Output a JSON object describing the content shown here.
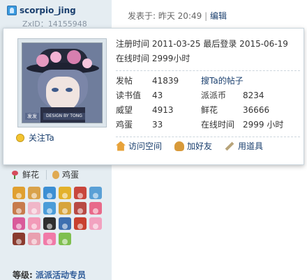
{
  "user": {
    "username": "scorpio_jing",
    "zxid": "ZxID：14155948"
  },
  "post": {
    "posted_label": "发表于: 昨天 20:49",
    "separator": "|",
    "edit_label": "编辑"
  },
  "card": {
    "register_line": "注册时间  2011-03-25  最后登录  2015-06-19",
    "online_line": "在线时间    2999小时",
    "avatar_tag_left": "发发",
    "avatar_tag_right": "DESIGN BY TONG",
    "follow_label": "关注Ta",
    "stats": [
      {
        "label": "发帖",
        "value": "41839",
        "label2": "搜Ta的帖子",
        "value2": ""
      },
      {
        "label": "读书值",
        "value": "43",
        "label2": "派派币",
        "value2": "8234"
      },
      {
        "label": "威望",
        "value": "4913",
        "label2": "鲜花",
        "value2": "36666"
      },
      {
        "label": "鸡蛋",
        "value": "33",
        "label2": "在线时间",
        "value2": "2999 小时"
      }
    ],
    "actions": {
      "visit_space": "访问空间",
      "add_friend": "加好友",
      "use_item": "用道具"
    }
  },
  "gifts": {
    "flower_label": "鲜花",
    "egg_label": "鸡蛋"
  },
  "medals": [
    "#e0a030",
    "#d9a24a",
    "#3d8fd4",
    "#e3b12b",
    "#c9463c",
    "#5aa0d6",
    "#c77b4d",
    "#f0b6c8",
    "#4a9cd8",
    "#d7a43c",
    "#b84a44",
    "#e86a8a",
    "#d95a9a",
    "#f29ab8",
    "#2f2f2f",
    "#3d6fb0",
    "#c8402f",
    "#f2a2c0",
    "#8a3b2f",
    "#e9a0b0",
    "#f07aa8",
    "#7fbf4f"
  ],
  "level": {
    "label": "等级:",
    "value": "派派活动专员"
  }
}
